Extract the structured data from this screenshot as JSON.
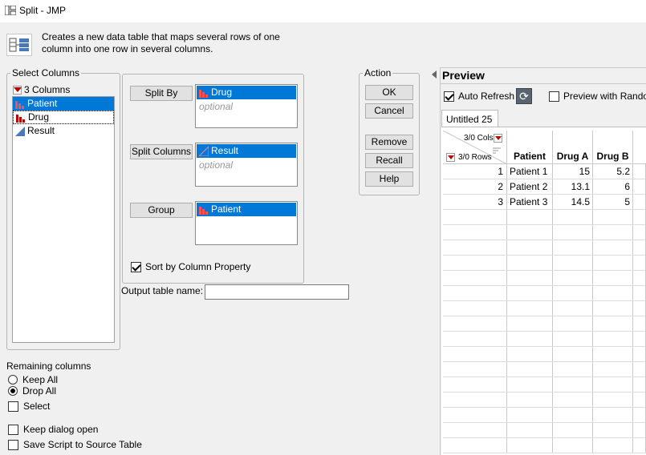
{
  "window": {
    "title": "Split - JMP"
  },
  "description": "Creates a new data table that maps several rows of one column into one row in several columns.",
  "select_columns": {
    "legend": "Select Columns",
    "count_label": "3 Columns",
    "items": [
      {
        "label": "Patient",
        "icon": "nominal-bar-icon"
      },
      {
        "label": "Drug",
        "icon": "nominal-bar-icon"
      },
      {
        "label": "Result",
        "icon": "continuous-triangle-icon"
      }
    ]
  },
  "roles": {
    "split_by": {
      "button": "Split By",
      "value": "Drug",
      "placeholder": "optional"
    },
    "split_columns": {
      "button": "Split Columns",
      "value": "Result",
      "placeholder": "optional"
    },
    "group": {
      "button": "Group",
      "value": "Patient"
    },
    "sort_label": "Sort by Column Property",
    "sort_checked": true
  },
  "output": {
    "label": "Output table name:",
    "value": ""
  },
  "action": {
    "legend": "Action",
    "ok": "OK",
    "cancel": "Cancel",
    "remove": "Remove",
    "recall": "Recall",
    "help": "Help"
  },
  "remaining": {
    "title": "Remaining columns",
    "keep_all": "Keep All",
    "drop_all": "Drop All",
    "select": "Select",
    "selected": "Drop All"
  },
  "options": {
    "keep_dialog": "Keep dialog open",
    "save_script": "Save Script to Source Table"
  },
  "preview": {
    "title": "Preview",
    "auto_refresh": "Auto Refresh",
    "preview_random": "Preview with Rando",
    "tab": "Untitled 25",
    "cols_info": "3/0 Cols",
    "rows_info": "3/0 Rows",
    "headers": [
      "Patient",
      "Drug A",
      "Drug B"
    ],
    "rows": [
      [
        "1",
        "Patient 1",
        "15",
        "5.2"
      ],
      [
        "2",
        "Patient 2",
        "13.1",
        "6"
      ],
      [
        "3",
        "Patient 3",
        "14.5",
        "5"
      ]
    ]
  },
  "colors": {
    "selection": "#0078d7",
    "accent_red": "#c00000"
  }
}
